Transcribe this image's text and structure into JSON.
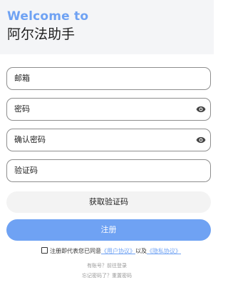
{
  "header": {
    "welcome": "Welcome to",
    "app_name": "阿尔法助手"
  },
  "fields": {
    "email": {
      "placeholder": "邮箱"
    },
    "password": {
      "placeholder": "密码"
    },
    "confirm_password": {
      "placeholder": "确认密码"
    },
    "code": {
      "placeholder": "验证码"
    }
  },
  "buttons": {
    "get_code": "获取验证码",
    "register": "注册"
  },
  "agreement": {
    "prefix": "注册即代表您已同意",
    "user_link": "《用户协议》",
    "middle": "以及",
    "privacy_link": "《隐私协议》"
  },
  "footer": {
    "has_account": "有账号？前往登录",
    "forgot": "忘记密码了？重置密码"
  },
  "colors": {
    "accent": "#6fa2f3",
    "header_bg": "#f4f5f7",
    "border": "#8e8e8e"
  }
}
